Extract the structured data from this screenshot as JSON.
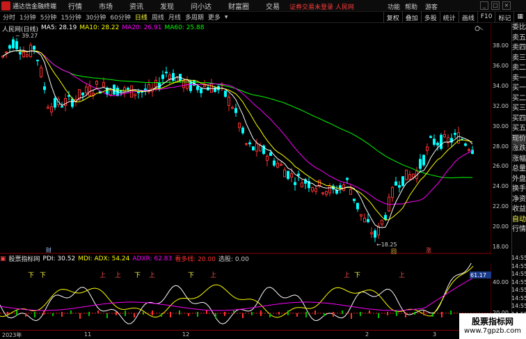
{
  "menubar": {
    "app_title": "通达信金融终端",
    "items": [
      "行情",
      "市场",
      "资讯",
      "发现",
      "问小达",
      "财富圈",
      "交易"
    ],
    "notice": "证券交易未登录",
    "notice_stock": "人民网",
    "right_items": [
      "功能",
      "帮助",
      "游客"
    ]
  },
  "periods": [
    "分时",
    "1分钟",
    "5分钟",
    "15分钟",
    "30分钟",
    "60分钟",
    "日线",
    "周线",
    "月线",
    "多周期",
    "更多"
  ],
  "active_period": "日线",
  "toolbar": [
    "复权",
    "叠加",
    "多股",
    "统计",
    "画线",
    "F10",
    "标记"
  ],
  "stock": {
    "name": "人民网(日线)",
    "ma5_label": "MA5: 28.19",
    "ma10_label": "MA10: 28.22",
    "ma20_label": "MA20: 26.91",
    "ma60_label": "MA60: 25.88",
    "colors": {
      "ma5": "#ffffff",
      "ma10": "#ffff00",
      "ma20": "#ff00ff",
      "ma60": "#00ff00",
      "up": "#ff3232",
      "down": "#00ffff"
    }
  },
  "price_axis": [
    "38.00",
    "36.00",
    "34.00",
    "32.00",
    "30.00",
    "28.00",
    "26.00",
    "24.00",
    "22.00",
    "20.00",
    "18.00"
  ],
  "markers": {
    "high": "39.27",
    "low": "18.25",
    "cai": "财",
    "zhang": "涨",
    "hui": "回"
  },
  "sidebar": [
    "委比",
    "卖五",
    "卖四",
    "卖三",
    "卖二",
    "卖一",
    "买一",
    "买二",
    "买三",
    "买四",
    "买五",
    "现价",
    "涨跌",
    "涨幅",
    "总量",
    "外盘",
    "换手",
    "净资",
    "收益",
    "自动",
    "行情"
  ],
  "time_labels": [
    "14:55",
    "14:55",
    "14:55",
    "14:55",
    "14:55",
    "14:55",
    "14:55",
    "14:55",
    "14:55",
    "14:55"
  ],
  "sub": {
    "name": "股票指标网",
    "pdi": "PDI: 30.52",
    "mdi": "MDI: ADX: 54.24",
    "adxr": "ADXR: 62.83",
    "mid": "看多线: 20.00",
    "xuan": "选股: 0.00",
    "axis": [
      "61.17",
      "40.00",
      "20.00"
    ],
    "texts_up": [
      "上",
      "上",
      "上",
      "上",
      "上",
      "上"
    ],
    "texts_down": [
      "下",
      "下",
      "下",
      "下",
      "下"
    ]
  },
  "x_axis": [
    "2023年",
    "11",
    "12",
    "2",
    "3"
  ],
  "watermark": {
    "line1": "股票指标网",
    "line2": "www.7gpzb.com"
  }
}
